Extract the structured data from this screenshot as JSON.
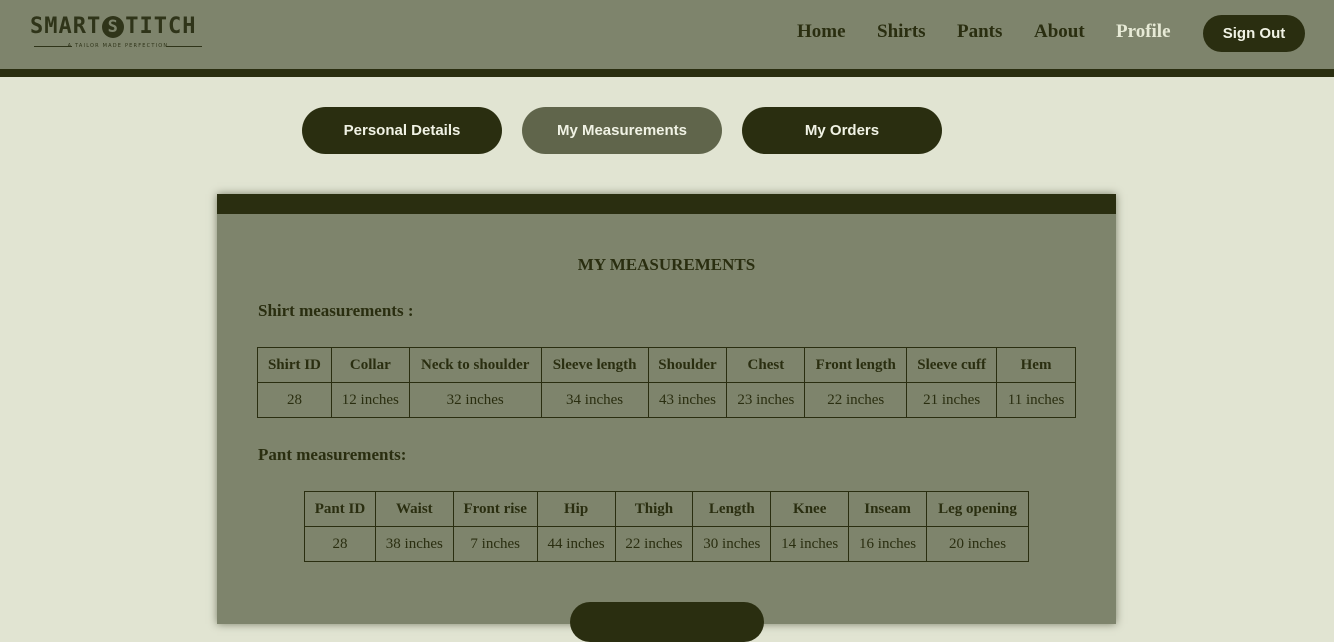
{
  "brand": {
    "name_before": "SMART",
    "name_mark": "S",
    "name_after": "TITCH",
    "tagline": "A TAILOR MADE PERFECTION"
  },
  "nav": {
    "items": [
      "Home",
      "Shirts",
      "Pants",
      "About",
      "Profile"
    ],
    "active": "Profile",
    "sign_out": "Sign Out"
  },
  "tabs": [
    "Personal Details",
    "My Measurements",
    "My Orders"
  ],
  "active_tab": "My Measurements",
  "card": {
    "title": "MY MEASUREMENTS",
    "shirt_section_label": "Shirt measurements :",
    "pant_section_label": "Pant measurements:"
  },
  "shirt_table": {
    "headers": [
      "Shirt ID",
      "Collar",
      "Neck to shoulder",
      "Sleeve length",
      "Shoulder",
      "Chest",
      "Front length",
      "Sleeve cuff",
      "Hem"
    ],
    "row": [
      "28",
      "12 inches",
      "32 inches",
      "34 inches",
      "43 inches",
      "23 inches",
      "22 inches",
      "21 inches",
      "11 inches"
    ]
  },
  "pant_table": {
    "headers": [
      "Pant ID",
      "Waist",
      "Front rise",
      "Hip",
      "Thigh",
      "Length",
      "Knee",
      "Inseam",
      "Leg opening"
    ],
    "row": [
      "28",
      "38 inches",
      "7 inches",
      "44 inches",
      "22 inches",
      "30 inches",
      "14 inches",
      "16 inches",
      "20 inches"
    ]
  },
  "colors": {
    "header_bg": "#7e846c",
    "dark_accent": "#2a2e10",
    "page_bg": "#e1e4d2",
    "active_tab_bg": "#60654b",
    "active_nav_text": "#e7ead6"
  }
}
